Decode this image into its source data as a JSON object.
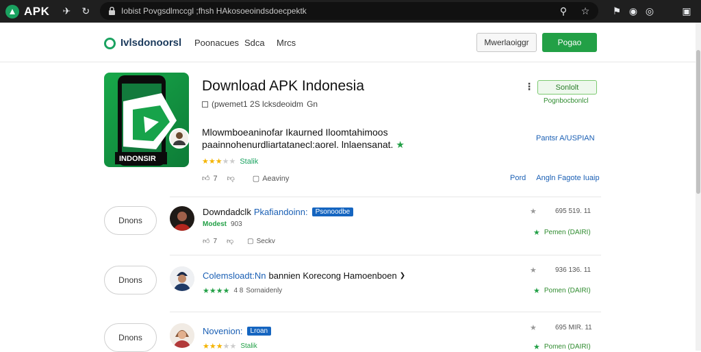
{
  "browser": {
    "brand": "APK",
    "url": "Iobist Povgsdlmccgl ;fhsh HAkosoeoindsdoecpektk"
  },
  "header": {
    "site_name": "Ivlsdonoorsl",
    "nav": [
      "Poonacues",
      "Sdca",
      "Mrcs"
    ],
    "outline_btn": "Mwerlaoiggr",
    "green_btn": "Pogao"
  },
  "hero": {
    "title": "Download APK Indonesia",
    "meta": "(pwemet1 2S lcksdeoidm",
    "meta_more": "Gn",
    "desc": "Mlowmboeaninofar Ikaurned Iloomtahimoos paainnohenurdliartatanecl:aorel. lnlaensanat.",
    "rating_label": "Stalik",
    "likes": "7",
    "comments_label": "Aeaviny",
    "icon_text": "INDONSIR",
    "side_btn": "Sonlolt",
    "side_note": "Pognbocbonlcl",
    "side_link": "Pantsr A/USPIAN",
    "right_links": [
      "Pord",
      "Angln Fagote Iuaip"
    ]
  },
  "rows": [
    {
      "pill": "Dnons",
      "title_dark": "Downdadclk",
      "title_blue": "Pkafiandoinn:",
      "badge": "Psonoodbe",
      "sub_label": "Modest",
      "sub_value": "903",
      "likes": "7",
      "comment_label": "Seckv",
      "num": "695 519. 11",
      "green": "Pemen (DAIRI)"
    },
    {
      "pill": "Dnons",
      "title_blue": "Colemsloadt:Nn",
      "title_dark": "bannien Korecong Hamoenboen",
      "sub_value": "4 8",
      "sub_label": "Sornaidenly",
      "num": "936 136. 11",
      "green": "Pomen (DAIRI)"
    },
    {
      "pill": "Dnons",
      "title_blue": "Novenion:",
      "badge": "Lroan",
      "sub_label": "Stalik",
      "num": "695 MIR. 11",
      "green": "Pomen (DAIRI)"
    }
  ]
}
